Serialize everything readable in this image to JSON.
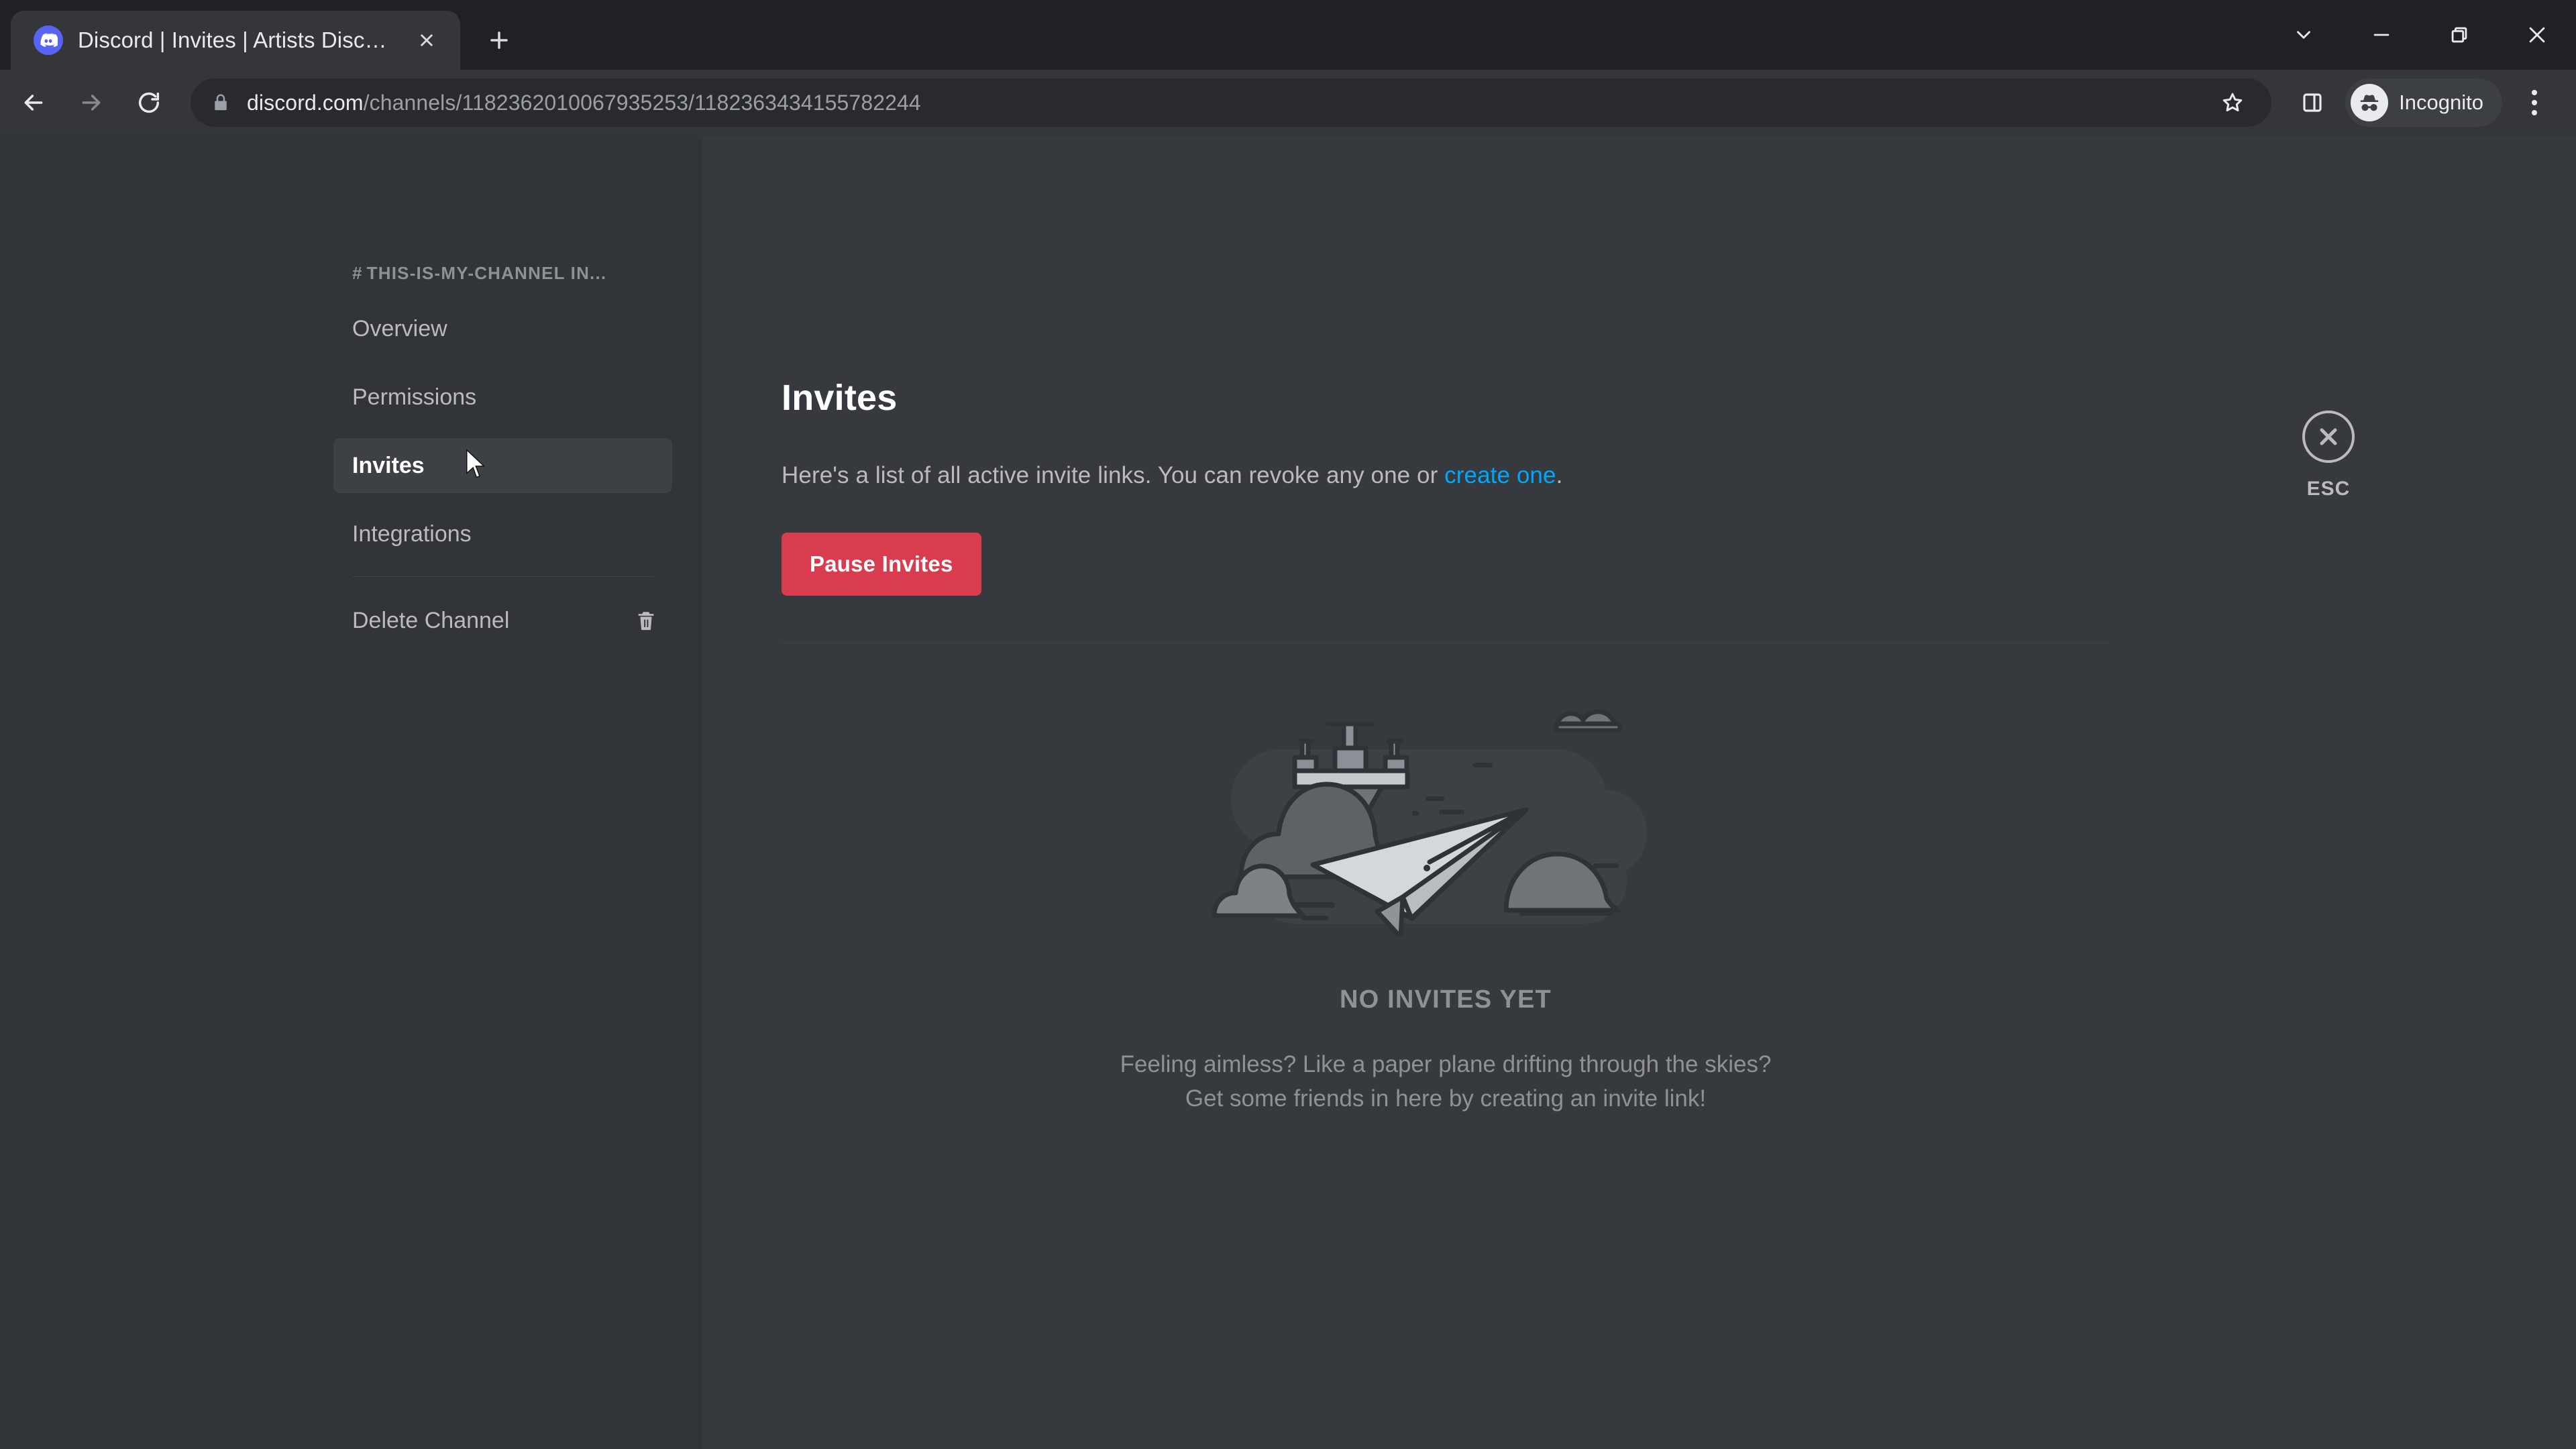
{
  "browser": {
    "tab": {
      "title": "Discord | Invites | Artists Discord",
      "favicon": "discord-icon",
      "close_icon": "close-icon"
    },
    "new_tab_icon": "plus-icon",
    "window_controls": [
      {
        "name": "tab-search-button",
        "icon": "chevron-down-icon"
      },
      {
        "name": "minimize-button",
        "icon": "minimize-icon"
      },
      {
        "name": "restore-button",
        "icon": "restore-icon"
      },
      {
        "name": "close-window-button",
        "icon": "close-icon"
      }
    ],
    "nav": {
      "back_icon": "arrow-left-icon",
      "forward_icon": "arrow-right-icon",
      "reload_icon": "reload-icon"
    },
    "omnibox": {
      "lock_icon": "lock-icon",
      "url_host": "discord.com",
      "url_path": "/channels/1182362010067935253/1182363434155782244",
      "bookmark_icon": "star-icon"
    },
    "side_panel_icon": "side-panel-icon",
    "profile": {
      "label": "Incognito",
      "avatar_icon": "incognito-icon"
    },
    "menu_icon": "three-dots-icon"
  },
  "sidebar": {
    "channel_header": "THIS-IS-MY-CHANNEL IN...",
    "hash": "#",
    "items": [
      {
        "label": "Overview",
        "active": false
      },
      {
        "label": "Permissions",
        "active": false
      },
      {
        "label": "Invites",
        "active": true
      },
      {
        "label": "Integrations",
        "active": false
      }
    ],
    "delete": {
      "label": "Delete Channel",
      "icon": "trash-icon"
    }
  },
  "main": {
    "title": "Invites",
    "description_before": "Here's a list of all active invite links. You can revoke any one or ",
    "description_link": "create one",
    "description_after": ".",
    "pause_button": "Pause Invites",
    "empty_state": {
      "illustration": "paper-plane-illustration",
      "title": "NO INVITES YET",
      "line1": "Feeling aimless? Like a paper plane drifting through the skies?",
      "line2": "Get some friends in here by creating an invite link!"
    }
  },
  "close_panel": {
    "icon": "close-icon",
    "label": "ESC"
  },
  "colors": {
    "accent_danger": "#d83c4e",
    "link": "#00a8fc",
    "sidebar_bg": "#313438",
    "content_bg": "#36393e",
    "brand": "#5865f2"
  }
}
